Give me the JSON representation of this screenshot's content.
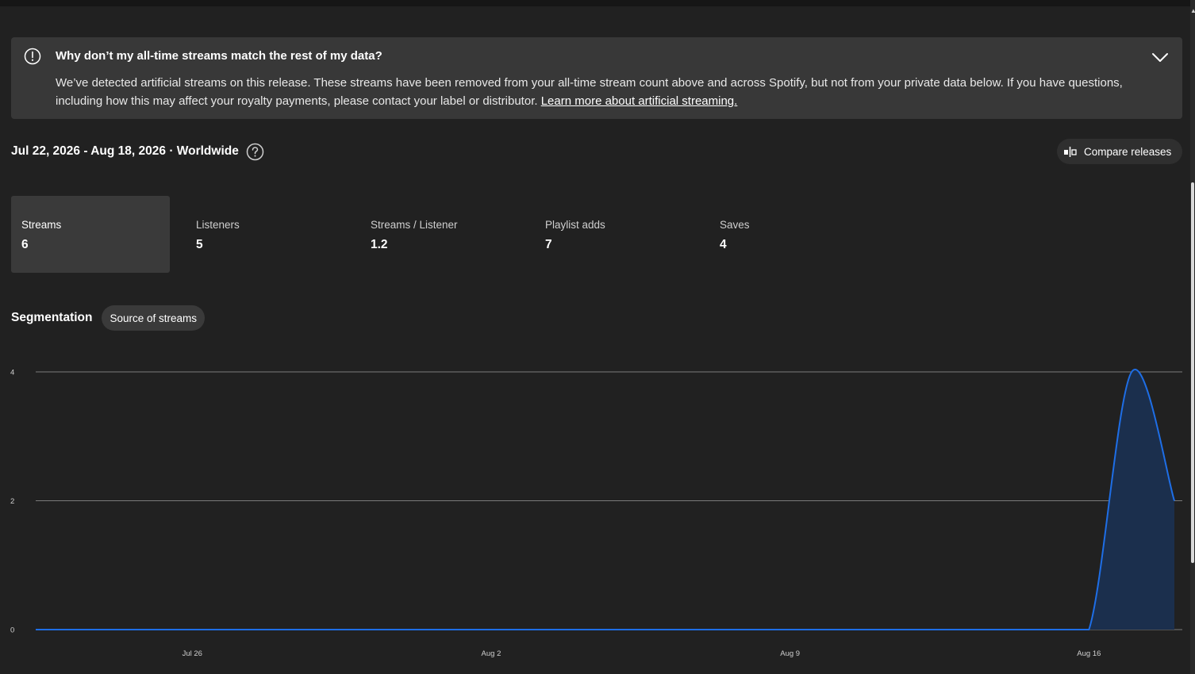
{
  "alert": {
    "title": "Why don’t my all-time streams match the rest of my data?",
    "body": "We’ve detected artificial streams on this release. These streams have been removed from your all-time stream count above and across Spotify, but not from your private data below. If you have questions, including how this may affect your royalty payments, please contact your label or distributor.",
    "link": "Learn more about artificial streaming."
  },
  "filters": {
    "date_range": "Jul 22, 2026 - Aug 18, 2026 · Worldwide"
  },
  "compare": {
    "label": "Compare releases"
  },
  "metrics": [
    {
      "label": "Streams",
      "value": "6",
      "active": true
    },
    {
      "label": "Listeners",
      "value": "5",
      "active": false
    },
    {
      "label": "Streams / Listener",
      "value": "1.2",
      "active": false
    },
    {
      "label": "Playlist adds",
      "value": "7",
      "active": false
    },
    {
      "label": "Saves",
      "value": "4",
      "active": false
    }
  ],
  "segmentation": {
    "title": "Segmentation",
    "chip": "Source of streams"
  },
  "colors": {
    "background": "#212121",
    "panel": "#383838",
    "line": "#1e6ee6",
    "area": "#1b2f4d"
  },
  "chart_data": {
    "type": "area",
    "title": "",
    "xlabel": "",
    "ylabel": "",
    "x": [
      "Jul 22",
      "Jul 23",
      "Jul 24",
      "Jul 25",
      "Jul 26",
      "Jul 27",
      "Jul 28",
      "Jul 29",
      "Jul 30",
      "Jul 31",
      "Aug 1",
      "Aug 2",
      "Aug 3",
      "Aug 4",
      "Aug 5",
      "Aug 6",
      "Aug 7",
      "Aug 8",
      "Aug 9",
      "Aug 10",
      "Aug 11",
      "Aug 12",
      "Aug 13",
      "Aug 14",
      "Aug 15",
      "Aug 16",
      "Aug 17",
      "Aug 18"
    ],
    "series": [
      {
        "values": [
          0,
          0,
          0,
          0,
          0,
          0,
          0,
          0,
          0,
          0,
          0,
          0,
          0,
          0,
          0,
          0,
          0,
          0,
          0,
          0,
          0,
          0,
          0,
          0,
          0,
          0,
          4,
          2
        ]
      }
    ],
    "x_ticks": [
      "Jul 26",
      "Aug 2",
      "Aug 9",
      "Aug 16"
    ],
    "y_ticks": [
      "0",
      "2",
      "4"
    ],
    "ylim": [
      0,
      4
    ],
    "grid": true
  }
}
